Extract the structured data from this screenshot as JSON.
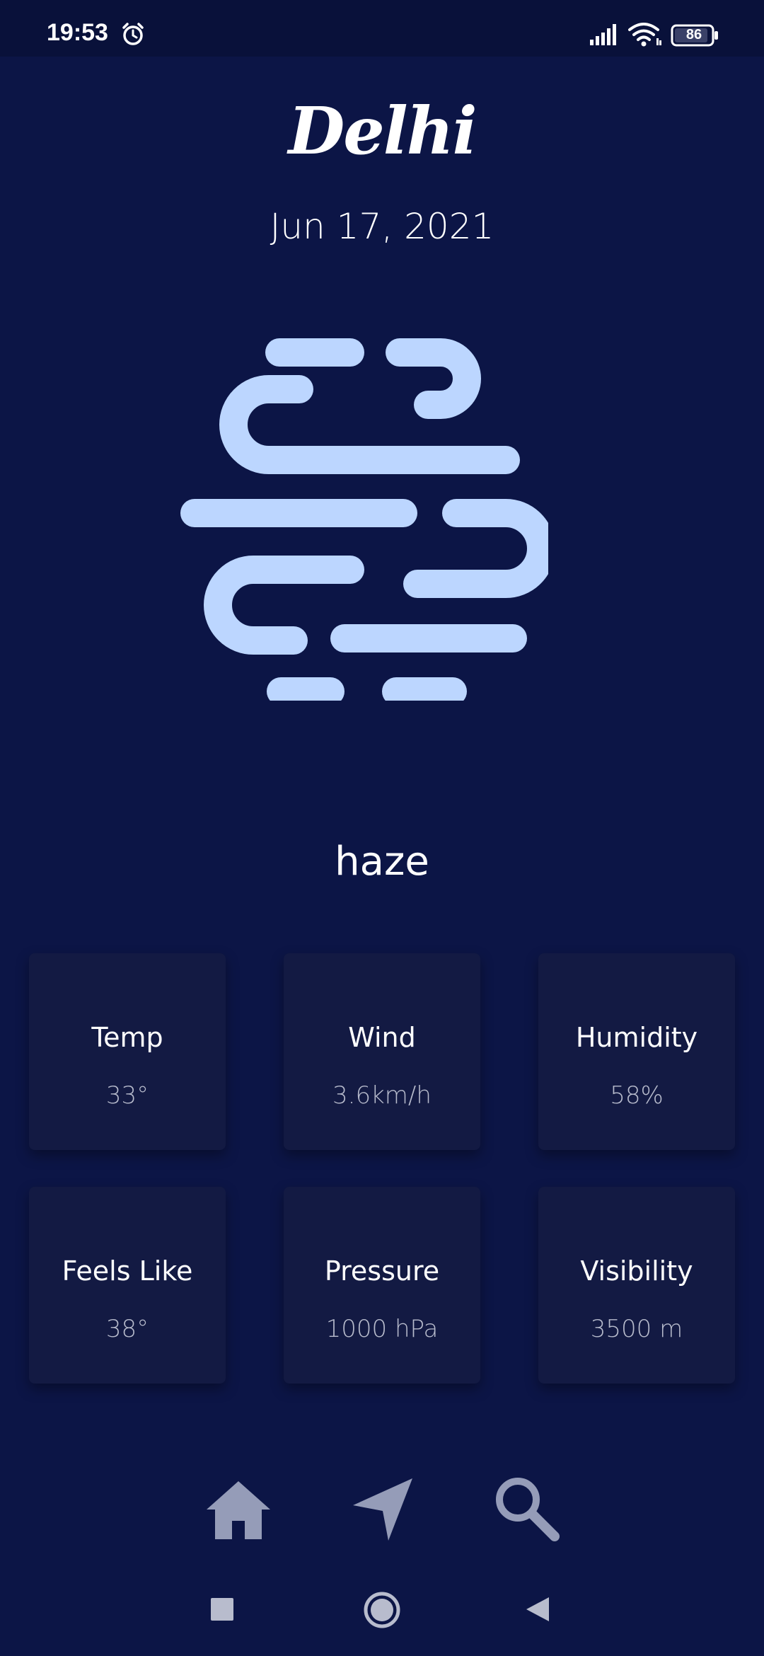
{
  "status_bar": {
    "time": "19:53",
    "battery": "86",
    "icons": [
      "alarm-icon",
      "signal-icon",
      "wifi-icon",
      "battery-icon"
    ]
  },
  "header": {
    "city": "Delhi",
    "date": "Jun 17, 2021"
  },
  "weather": {
    "icon": "haze-icon",
    "condition": "haze",
    "icon_color": "#bcd6ff"
  },
  "stats": [
    {
      "label": "Temp",
      "value": "33°"
    },
    {
      "label": "Wind",
      "value": "3.6km/h"
    },
    {
      "label": "Humidity",
      "value": "58%"
    },
    {
      "label": "Feels Like",
      "value": "38°"
    },
    {
      "label": "Pressure",
      "value": "1000 hPa"
    },
    {
      "label": "Visibility",
      "value": "3500 m"
    }
  ],
  "bottom_nav": {
    "items": [
      "home-icon",
      "location-arrow-icon",
      "search-icon"
    ],
    "icon_color": "#959cb8"
  },
  "system_nav": {
    "items": [
      "recents-button",
      "home-button",
      "back-button"
    ]
  },
  "colors": {
    "background": "#0c1546",
    "card": "#131a43",
    "value_text": "#b8bccd"
  }
}
